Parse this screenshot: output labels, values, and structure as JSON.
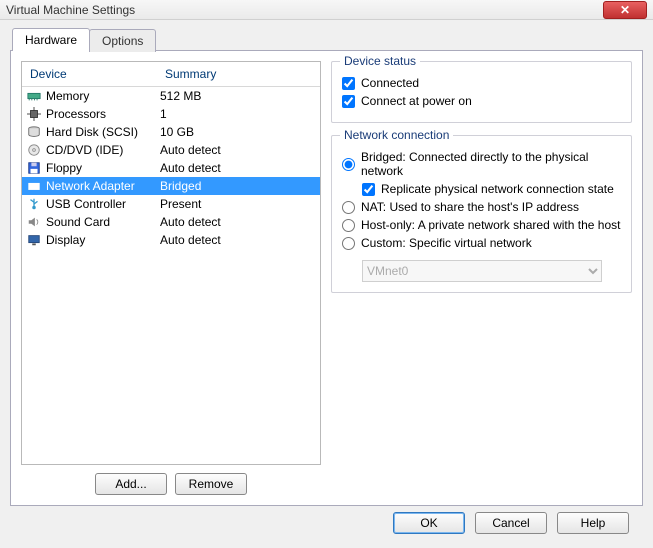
{
  "window": {
    "title": "Virtual Machine Settings",
    "close_glyph": "✕"
  },
  "tabs": {
    "hardware": "Hardware",
    "options": "Options"
  },
  "list": {
    "header_device": "Device",
    "header_summary": "Summary",
    "rows": [
      {
        "icon": "memory-icon",
        "device": "Memory",
        "summary": "512 MB"
      },
      {
        "icon": "cpu-icon",
        "device": "Processors",
        "summary": "1"
      },
      {
        "icon": "hdd-icon",
        "device": "Hard Disk (SCSI)",
        "summary": "10 GB"
      },
      {
        "icon": "cd-icon",
        "device": "CD/DVD (IDE)",
        "summary": "Auto detect"
      },
      {
        "icon": "floppy-icon",
        "device": "Floppy",
        "summary": "Auto detect"
      },
      {
        "icon": "nic-icon",
        "device": "Network Adapter",
        "summary": "Bridged"
      },
      {
        "icon": "usb-icon",
        "device": "USB Controller",
        "summary": "Present"
      },
      {
        "icon": "sound-icon",
        "device": "Sound Card",
        "summary": "Auto detect"
      },
      {
        "icon": "display-icon",
        "device": "Display",
        "summary": "Auto detect"
      }
    ],
    "selected_index": 5
  },
  "buttons": {
    "add": "Add...",
    "remove": "Remove",
    "ok": "OK",
    "cancel": "Cancel",
    "help": "Help"
  },
  "device_status": {
    "legend": "Device status",
    "connected_label": "Connected",
    "connected_checked": true,
    "connect_poweron_label": "Connect at power on",
    "connect_poweron_checked": true
  },
  "network_connection": {
    "legend": "Network connection",
    "bridged_label": "Bridged: Connected directly to the physical network",
    "replicate_label": "Replicate physical network connection state",
    "replicate_checked": true,
    "nat_label": "NAT: Used to share the host's IP address",
    "hostonly_label": "Host-only: A private network shared with the host",
    "custom_label": "Custom: Specific virtual network",
    "selected": "bridged",
    "vmnet_options": [
      "VMnet0"
    ],
    "vmnet_selected": "VMnet0",
    "vmnet_enabled": false
  }
}
